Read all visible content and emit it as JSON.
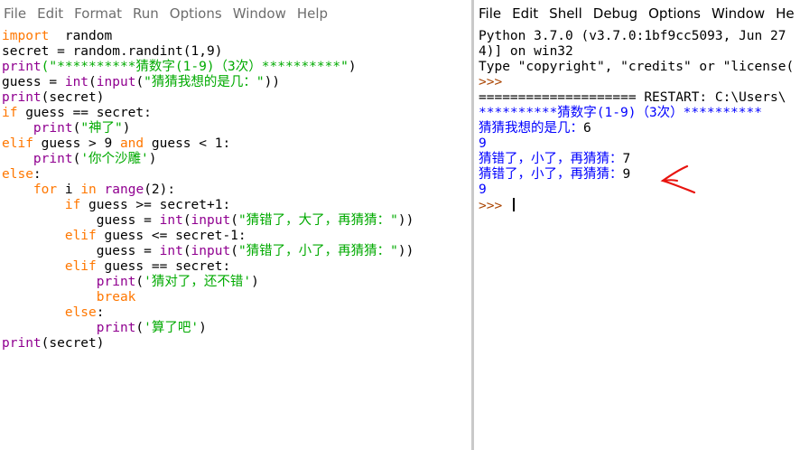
{
  "editor": {
    "menu": [
      "File",
      "Edit",
      "Format",
      "Run",
      "Options",
      "Window",
      "Help"
    ],
    "lines": [
      [
        [
          "kw",
          "import"
        ],
        [
          "",
          "  random"
        ]
      ],
      [
        [
          "",
          "secret = random.randint(1,9)"
        ]
      ],
      [
        [
          "bi",
          "print"
        ],
        [
          "str",
          "(\"**********猜数字(1-9)（3次）**********\""
        ],
        [
          "",
          ")"
        ]
      ],
      [
        [
          "",
          "guess = "
        ],
        [
          "bi",
          "int"
        ],
        [
          "",
          "("
        ],
        [
          "bi",
          "input"
        ],
        [
          "",
          "("
        ],
        [
          "str",
          "\"猜猜我想的是几：\""
        ],
        [
          "",
          "))"
        ]
      ],
      [
        [
          "bi",
          "print"
        ],
        [
          "",
          "(secret)"
        ]
      ],
      [
        [
          "kw",
          "if"
        ],
        [
          "",
          " guess == secret:"
        ]
      ],
      [
        [
          "",
          "    "
        ],
        [
          "bi",
          "print"
        ],
        [
          "",
          "("
        ],
        [
          "str",
          "\"神了\""
        ],
        [
          "",
          ")"
        ]
      ],
      [
        [
          "kw",
          "elif"
        ],
        [
          "",
          " guess > 9 "
        ],
        [
          "kw",
          "and"
        ],
        [
          "",
          " guess < 1:"
        ]
      ],
      [
        [
          "",
          "    "
        ],
        [
          "bi",
          "print"
        ],
        [
          "",
          "("
        ],
        [
          "str",
          "'你个沙雕'"
        ],
        [
          "",
          ")"
        ]
      ],
      [
        [
          "kw",
          "else"
        ],
        [
          "",
          ":"
        ]
      ],
      [
        [
          "",
          "    "
        ],
        [
          "kw",
          "for"
        ],
        [
          "",
          " i "
        ],
        [
          "kw",
          "in"
        ],
        [
          "",
          " "
        ],
        [
          "bi",
          "range"
        ],
        [
          "",
          "(2):"
        ]
      ],
      [
        [
          "",
          "        "
        ],
        [
          "kw",
          "if"
        ],
        [
          "",
          " guess >= secret+1:"
        ]
      ],
      [
        [
          "",
          "            guess = "
        ],
        [
          "bi",
          "int"
        ],
        [
          "",
          "("
        ],
        [
          "bi",
          "input"
        ],
        [
          "",
          "("
        ],
        [
          "str",
          "\"猜错了，大了，再猜猜：\""
        ],
        [
          "",
          "))"
        ]
      ],
      [
        [
          "",
          "        "
        ],
        [
          "kw",
          "elif"
        ],
        [
          "",
          " guess <= secret-1:"
        ]
      ],
      [
        [
          "",
          "            guess = "
        ],
        [
          "bi",
          "int"
        ],
        [
          "",
          "("
        ],
        [
          "bi",
          "input"
        ],
        [
          "",
          "("
        ],
        [
          "str",
          "\"猜错了，小了，再猜猜：\""
        ],
        [
          "",
          "))"
        ]
      ],
      [
        [
          "",
          "        "
        ],
        [
          "kw",
          "elif"
        ],
        [
          "",
          " guess == secret:"
        ]
      ],
      [
        [
          "",
          "            "
        ],
        [
          "bi",
          "print"
        ],
        [
          "",
          "("
        ],
        [
          "str",
          "'猜对了，还不错'"
        ],
        [
          "",
          ")"
        ]
      ],
      [
        [
          "",
          "            "
        ],
        [
          "kw",
          "break"
        ]
      ],
      [
        [
          "",
          "        "
        ],
        [
          "kw",
          "else"
        ],
        [
          "",
          ":"
        ]
      ],
      [
        [
          "",
          "            "
        ],
        [
          "bi",
          "print"
        ],
        [
          "",
          "("
        ],
        [
          "str",
          "'算了吧'"
        ],
        [
          "",
          ")"
        ]
      ],
      [
        [
          "bi",
          "print"
        ],
        [
          "",
          "(secret)"
        ]
      ]
    ]
  },
  "shell": {
    "menu": [
      "File",
      "Edit",
      "Shell",
      "Debug",
      "Options",
      "Window",
      "He"
    ],
    "lines": [
      [
        [
          "",
          "Python 3.7.0 (v3.7.0:1bf9cc5093, Jun 27"
        ]
      ],
      [
        [
          "",
          "4)] on win32"
        ]
      ],
      [
        [
          "",
          "Type \"copyright\", \"credits\" or \"license("
        ]
      ],
      [
        [
          "prompt",
          ">>>"
        ]
      ],
      [
        [
          "",
          "==================== RESTART: C:\\Users\\"
        ]
      ],
      [
        [
          "out",
          "**********猜数字(1-9)（3次）**********"
        ]
      ],
      [
        [
          "out",
          "猜猜我想的是几："
        ],
        [
          "",
          "6"
        ]
      ],
      [
        [
          "out",
          "9"
        ]
      ],
      [
        [
          "out",
          "猜错了，小了，再猜猜："
        ],
        [
          "",
          "7"
        ]
      ],
      [
        [
          "out",
          "猜错了，小了，再猜猜："
        ],
        [
          "",
          "9"
        ]
      ],
      [
        [
          "out",
          "9"
        ]
      ],
      [
        [
          "prompt",
          ">>> "
        ]
      ]
    ]
  },
  "colors": {
    "keyword": "#ff7700",
    "builtin": "#900090",
    "string": "#00aa00",
    "output": "#0000ff",
    "prompt": "#aa4400",
    "annotation": "#e8140f"
  }
}
